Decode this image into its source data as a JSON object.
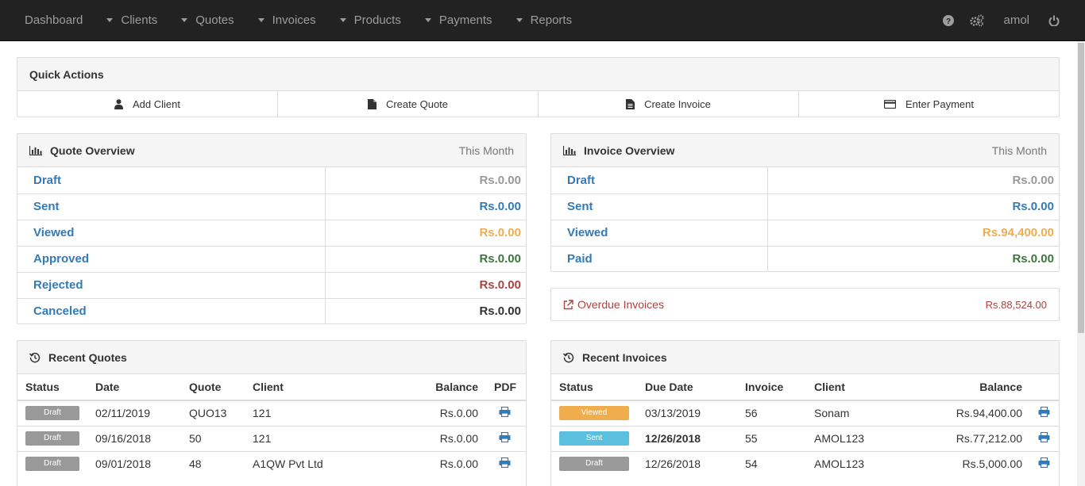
{
  "nav": {
    "dashboard": "Dashboard",
    "menus": [
      "Clients",
      "Quotes",
      "Invoices",
      "Products",
      "Payments",
      "Reports"
    ],
    "user": "amol"
  },
  "quick_actions": {
    "title": "Quick Actions",
    "buttons": [
      "Add Client",
      "Create Quote",
      "Create Invoice",
      "Enter Payment"
    ]
  },
  "quote_overview": {
    "title": "Quote Overview",
    "period": "This Month",
    "rows": [
      {
        "label": "Draft",
        "amount": "Rs.0.00",
        "color": "#999999"
      },
      {
        "label": "Sent",
        "amount": "Rs.0.00",
        "color": "#337ab7"
      },
      {
        "label": "Viewed",
        "amount": "Rs.0.00",
        "color": "#f0ad4e"
      },
      {
        "label": "Approved",
        "amount": "Rs.0.00",
        "color": "#3c763d"
      },
      {
        "label": "Rejected",
        "amount": "Rs.0.00",
        "color": "#a94442"
      },
      {
        "label": "Canceled",
        "amount": "Rs.0.00",
        "color": "#333333"
      }
    ]
  },
  "invoice_overview": {
    "title": "Invoice Overview",
    "period": "This Month",
    "rows": [
      {
        "label": "Draft",
        "amount": "Rs.0.00",
        "color": "#999999"
      },
      {
        "label": "Sent",
        "amount": "Rs.0.00",
        "color": "#337ab7"
      },
      {
        "label": "Viewed",
        "amount": "Rs.94,400.00",
        "color": "#f0ad4e"
      },
      {
        "label": "Paid",
        "amount": "Rs.0.00",
        "color": "#3c763d"
      }
    ]
  },
  "overdue": {
    "label": "Overdue Invoices",
    "amount": "Rs.88,524.00"
  },
  "recent_quotes": {
    "title": "Recent Quotes",
    "headers": [
      "Status",
      "Date",
      "Quote",
      "Client",
      "Balance",
      "PDF"
    ],
    "rows": [
      {
        "status": "Draft",
        "status_color": "#999999",
        "date": "02/11/2019",
        "quote": "QUO13",
        "client": "121",
        "balance": "Rs.0.00"
      },
      {
        "status": "Draft",
        "status_color": "#999999",
        "date": "09/16/2018",
        "quote": "50",
        "client": "121",
        "balance": "Rs.0.00"
      },
      {
        "status": "Draft",
        "status_color": "#999999",
        "date": "09/01/2018",
        "quote": "48",
        "client": "A1QW Pvt Ltd",
        "balance": "Rs.0.00"
      }
    ]
  },
  "recent_invoices": {
    "title": "Recent Invoices",
    "headers": [
      "Status",
      "Due Date",
      "Invoice",
      "Client",
      "Balance"
    ],
    "rows": [
      {
        "status": "Viewed",
        "status_color": "#f0ad4e",
        "due_date": "03/13/2019",
        "overdue": false,
        "invoice": "56",
        "client": "Sonam",
        "balance": "Rs.94,400.00"
      },
      {
        "status": "Sent",
        "status_color": "#5bc0de",
        "due_date": "12/26/2018",
        "overdue": true,
        "invoice": "55",
        "client": "AMOL123",
        "balance": "Rs.77,212.00"
      },
      {
        "status": "Draft",
        "status_color": "#999999",
        "due_date": "12/26/2018",
        "overdue": false,
        "invoice": "54",
        "client": "AMOL123",
        "balance": "Rs.5,000.00"
      }
    ]
  },
  "icons": {
    "help": "question-circle-icon",
    "settings": "cogs-icon",
    "logout": "power-off-icon",
    "chart": "bar-chart-icon",
    "history": "history-icon",
    "print": "print-icon"
  }
}
